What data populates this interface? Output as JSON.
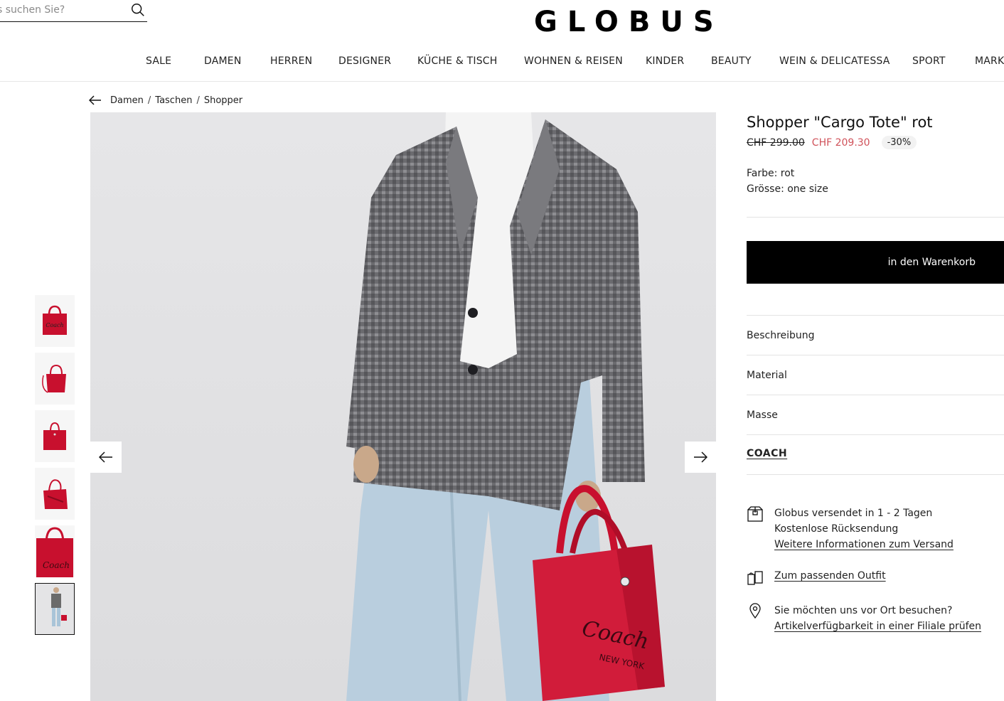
{
  "header": {
    "search_placeholder": "s suchen Sie?",
    "logo": "GLOBUS"
  },
  "nav": [
    {
      "label": "SALE"
    },
    {
      "label": "DAMEN"
    },
    {
      "label": "HERREN"
    },
    {
      "label": "DESIGNER"
    },
    {
      "label": "KÜCHE & TISCH"
    },
    {
      "label": "WOHNEN & REISEN"
    },
    {
      "label": "KINDER"
    },
    {
      "label": "BEAUTY"
    },
    {
      "label": "WEIN & DELICATESSA"
    },
    {
      "label": "SPORT"
    },
    {
      "label": "MARK"
    }
  ],
  "breadcrumb": {
    "items": [
      "Damen",
      "Taschen",
      "Shopper"
    ],
    "separator": "/"
  },
  "product": {
    "title": "Shopper \"Cargo Tote\" rot",
    "old_price": "CHF 299.00",
    "new_price": "CHF 209.30",
    "discount": "-30%",
    "color": "Farbe: rot",
    "size": "Grösse: one size",
    "cart_button": "in den Warenkorb",
    "sections": [
      "Beschreibung",
      "Material",
      "Masse"
    ],
    "brand": "COACH",
    "price_color": "#d0525a"
  },
  "info": {
    "shipping_line1": "Globus versendet in 1 - 2 Tagen",
    "shipping_line2": "Kostenlose Rücksendung",
    "shipping_link": "Weitere Informationen zum Versand",
    "outfit_link": "Zum passenden Outfit",
    "store_text": "Sie möchten uns vor Ort besuchen?",
    "store_link": "Artikelverfügbarkeit in einer Filiale prüfen"
  },
  "gallery": {
    "thumbnail_count": 6,
    "active_thumbnail": 6,
    "bag_color": "#d11c3a"
  }
}
